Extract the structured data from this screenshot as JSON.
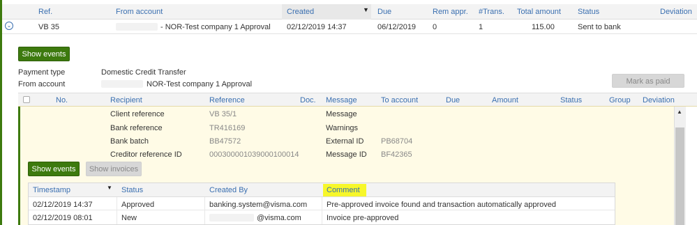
{
  "main_table": {
    "headers": [
      "Ref.",
      "From account",
      "Created",
      "Due",
      "Rem appr.",
      "#Trans.",
      "Total amount",
      "Status",
      "Deviation"
    ],
    "row": {
      "ref": "VB 35",
      "from_account": "- NOR-Test company 1 Approval",
      "created": "02/12/2019 14:37",
      "due": "06/12/2019",
      "rem_appr": "0",
      "trans": "1",
      "total_amount": "115.00",
      "status": "Sent to bank"
    }
  },
  "details": {
    "show_events_label": "Show events",
    "payment_type_label": "Payment type",
    "payment_type_value": "Domestic Credit Transfer",
    "from_account_label": "From account",
    "from_account_value": "NOR-Test company 1 Approval",
    "mark_as_paid_label": "Mark as paid"
  },
  "trans_table": {
    "headers": [
      "No.",
      "Recipient",
      "Reference",
      "Doc.",
      "Message",
      "To account",
      "Due",
      "Amount",
      "Status",
      "Group",
      "Deviation"
    ]
  },
  "trans_detail": {
    "client_reference_label": "Client reference",
    "client_reference_value": "VB 35/1",
    "bank_reference_label": "Bank reference",
    "bank_reference_value": "TR416169",
    "bank_batch_label": "Bank batch",
    "bank_batch_value": "BB47572",
    "creditor_ref_label": "Creditor reference ID",
    "creditor_ref_value": "000300001039000100014",
    "message_label": "Message",
    "warnings_label": "Warnings",
    "external_id_label": "External ID",
    "external_id_value": "PB68704",
    "message_id_label": "Message ID",
    "message_id_value": "BF42365",
    "show_events_label": "Show events",
    "show_invoices_label": "Show invoices"
  },
  "events": {
    "headers": [
      "Timestamp",
      "Status",
      "Created By",
      "Comment"
    ],
    "rows": [
      {
        "timestamp": "02/12/2019 14:37",
        "status": "Approved",
        "created_by": "banking.system@visma.com",
        "comment": "Pre-approved invoice found and transaction automatically approved"
      },
      {
        "timestamp": "02/12/2019 08:01",
        "status": "New",
        "created_by": "@visma.com",
        "comment": "Invoice pre-approved"
      }
    ]
  },
  "colors": {
    "accent_green": "#3d7a0e",
    "link_blue": "#3a6fb0",
    "highlight_yellow": "#f7f72a",
    "detail_bg": "#fffbe6"
  }
}
